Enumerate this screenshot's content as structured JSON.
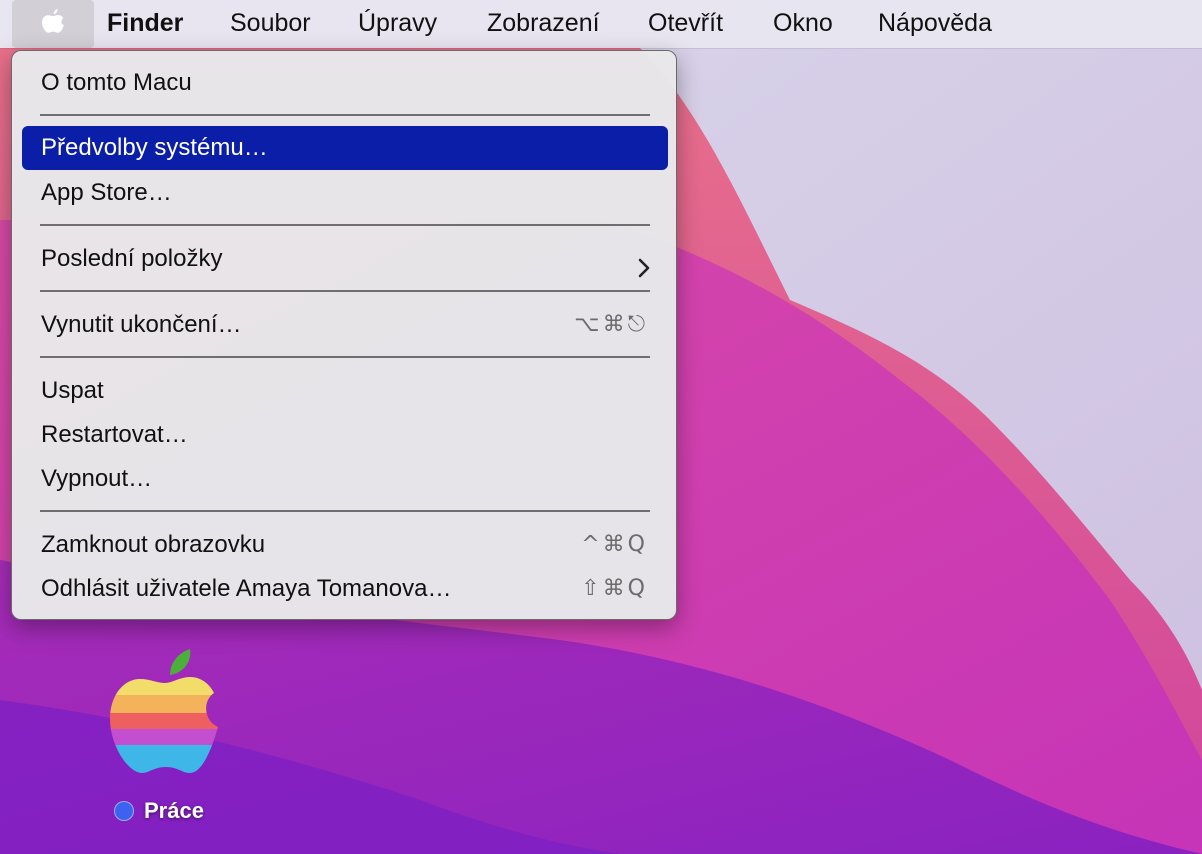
{
  "menubar": {
    "apple_icon": "apple-logo-icon",
    "app_name": "Finder",
    "items": [
      "Soubor",
      "Úpravy",
      "Zobrazení",
      "Otevřít",
      "Okno",
      "Nápověda"
    ]
  },
  "apple_menu": {
    "about": "O tomto Macu",
    "system_prefs": "Předvolby systému…",
    "app_store": "App Store…",
    "recent_items": "Poslední položky",
    "force_quit": "Vynutit ukončení…",
    "force_quit_shortcut": "⌥⌘⎋",
    "sleep": "Uspat",
    "restart": "Restartovat…",
    "shutdown": "Vypnout…",
    "lock_screen": "Zamknout obrazovku",
    "lock_screen_shortcut": "^⌘Q",
    "logout": "Odhlásit uživatele Amaya Tomanova…",
    "logout_shortcut": "⇧⌘Q"
  },
  "desktop": {
    "icon_label": "Práce",
    "tag_color": "#3c63ef"
  },
  "colors": {
    "highlight": "#0a1ea8",
    "menubar": "#e8e6f0"
  }
}
